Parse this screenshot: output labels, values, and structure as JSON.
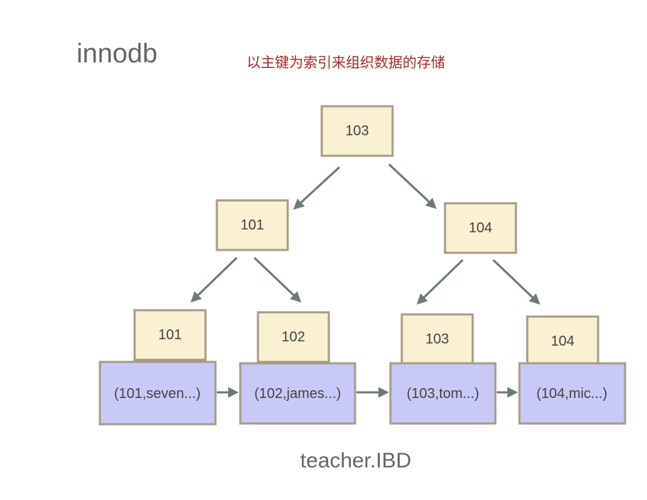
{
  "title": "innodb",
  "subtitle": "以主键为索引来组织数据的存储",
  "file_label": "teacher.IBD",
  "colors": {
    "key_fill": "#faf0d2",
    "row_fill": "#c9c9f7",
    "border": "#a59d88",
    "arrow": "#6d7b78",
    "subtitle": "#a52a2a",
    "text": "#444444"
  },
  "tree": {
    "root": "103",
    "internal": [
      "101",
      "104"
    ],
    "leaf_keys": [
      "101",
      "102",
      "103",
      "104"
    ]
  },
  "rows": [
    "(101,seven...)",
    "(102,james...)",
    "(103,tom...)",
    "(104,mic...)"
  ]
}
